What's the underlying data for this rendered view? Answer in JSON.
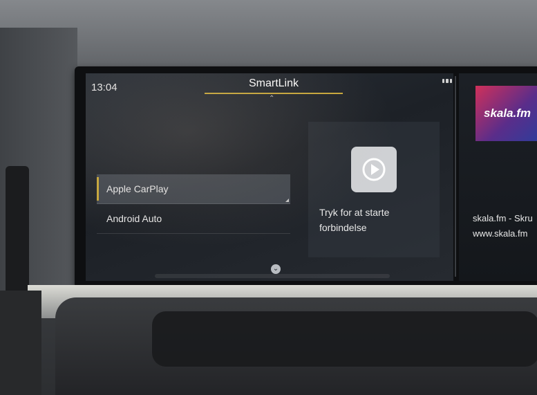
{
  "screen": {
    "time": "13:04",
    "title": "SmartLink",
    "menu": [
      {
        "label": "Apple CarPlay",
        "selected": true
      },
      {
        "label": "Android Auto",
        "selected": false
      }
    ],
    "connect_text": "Tryk for at starte forbindelse",
    "accent_color": "#c8a83a"
  },
  "right_screen": {
    "logo_text": "skala.fm",
    "line1": "skala.fm - Skru",
    "line2": "www.skala.fm"
  }
}
